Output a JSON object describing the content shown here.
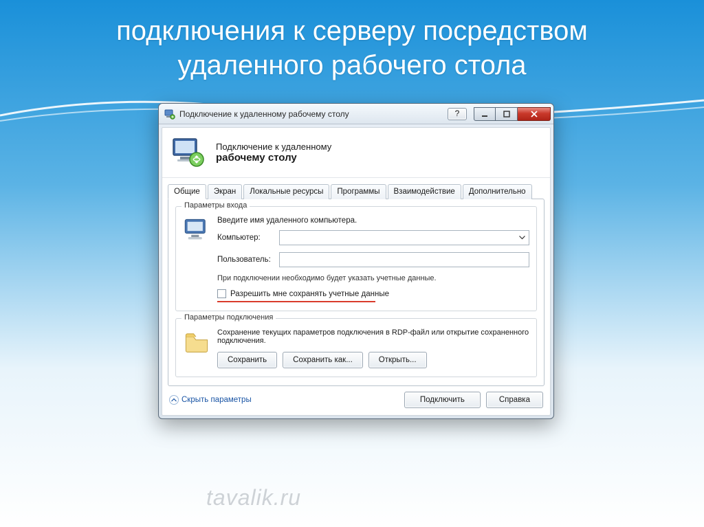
{
  "slide": {
    "title": "подключения к серверу посредством удаленного рабочего стола"
  },
  "window": {
    "title": "Подключение к удаленному рабочему столу",
    "help_label": "?",
    "banner_line1": "Подключение к удаленному",
    "banner_line2": "рабочему столу"
  },
  "tabs": [
    {
      "label": "Общие",
      "active": true
    },
    {
      "label": "Экран",
      "active": false
    },
    {
      "label": "Локальные ресурсы",
      "active": false
    },
    {
      "label": "Программы",
      "active": false
    },
    {
      "label": "Взаимодействие",
      "active": false
    },
    {
      "label": "Дополнительно",
      "active": false
    }
  ],
  "login_group": {
    "legend": "Параметры входа",
    "intro": "Введите имя удаленного компьютера.",
    "computer_label": "Компьютер:",
    "computer_value": "",
    "user_label": "Пользователь:",
    "user_value": "",
    "creds_note": "При подключении необходимо будет указать учетные данные.",
    "save_creds_label": "Разрешить мне сохранять учетные данные"
  },
  "conn_group": {
    "legend": "Параметры подключения",
    "text": "Сохранение текущих параметров подключения в RDP-файл или открытие сохраненного подключения.",
    "save_btn": "Сохранить",
    "saveas_btn": "Сохранить как...",
    "open_btn": "Открыть..."
  },
  "footer": {
    "toggle_label": "Скрыть параметры",
    "connect_btn": "Подключить",
    "help_btn": "Справка"
  },
  "watermark": "tavalik.ru"
}
